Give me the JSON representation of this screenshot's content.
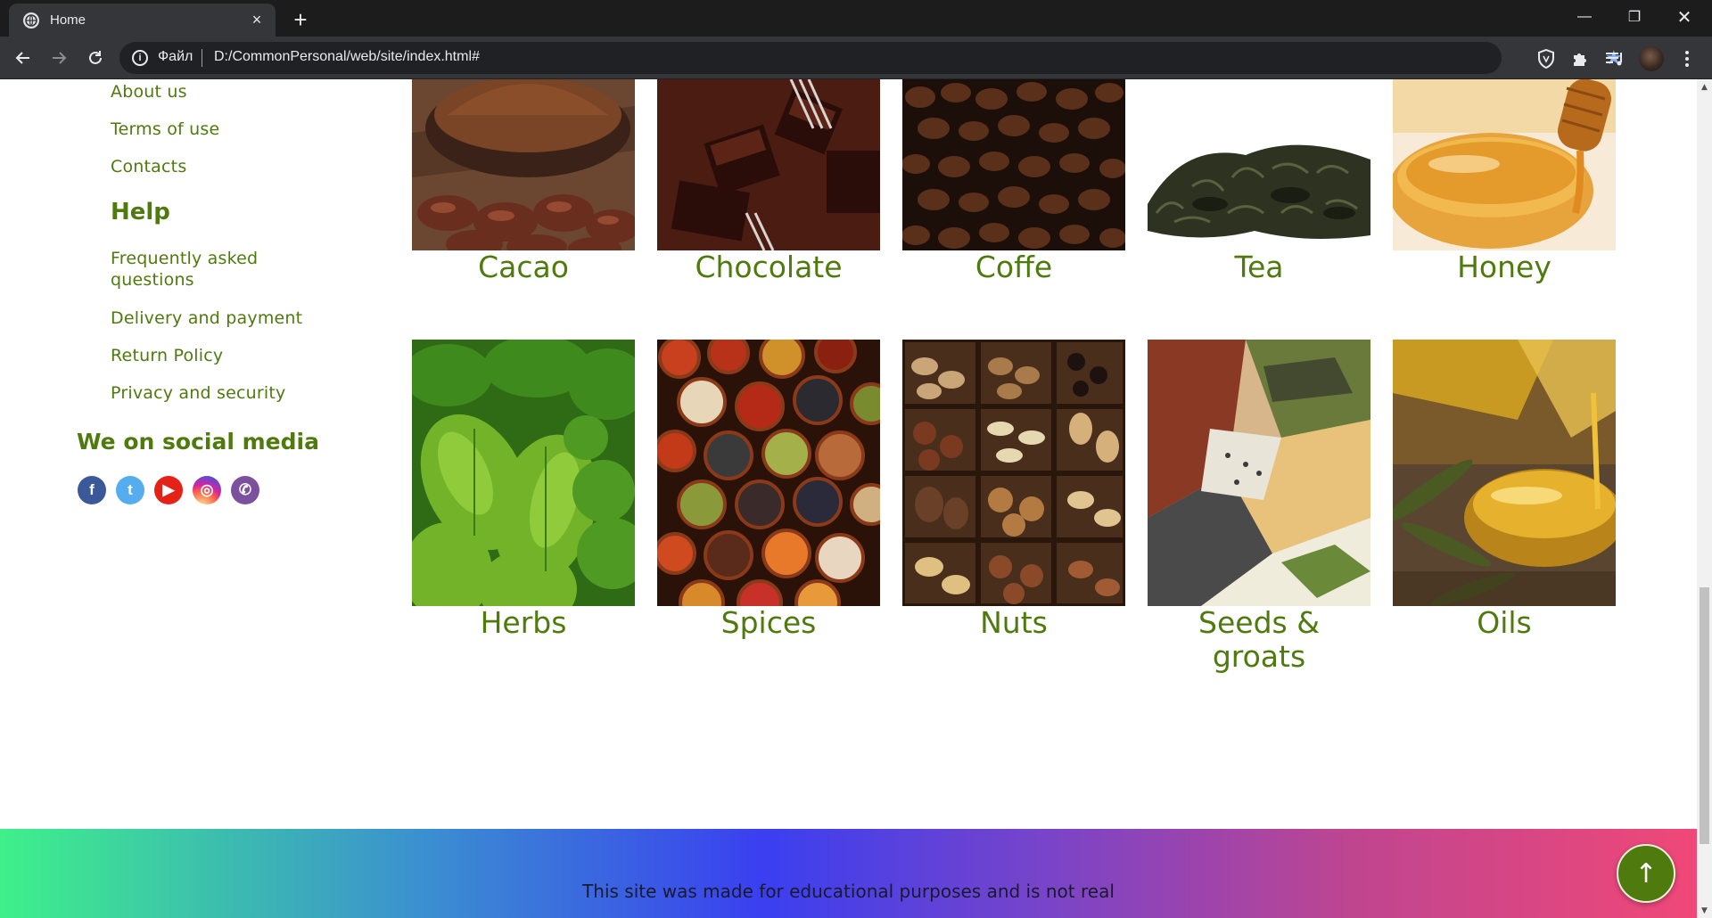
{
  "browser": {
    "tab_title": "Home",
    "tab_close": "×",
    "new_tab": "+",
    "url_scheme": "Файл",
    "url": "D:/CommonPersonal/web/site/index.html#",
    "info_icon": "i",
    "star_icon": "★",
    "minimize": "—",
    "restore": "❐",
    "close": "✕"
  },
  "sidebar": {
    "company_links": [
      "About us",
      "Terms of use",
      "Contacts"
    ],
    "help_heading": "Help",
    "help_links": [
      "Frequently asked questions",
      "Delivery and payment",
      "Return Policy",
      "Privacy and security"
    ],
    "social_heading": "We on social media",
    "social_icons": [
      {
        "name": "facebook-icon",
        "glyph": "f"
      },
      {
        "name": "twitter-icon",
        "glyph": "t"
      },
      {
        "name": "youtube-icon",
        "glyph": "▶"
      },
      {
        "name": "instagram-icon",
        "glyph": "◎"
      },
      {
        "name": "viber-icon",
        "glyph": "✆"
      }
    ]
  },
  "products": [
    {
      "name": "Cacao",
      "image": "cacao-image"
    },
    {
      "name": "Chocolate",
      "image": "chocolate-image"
    },
    {
      "name": "Coffe",
      "image": "coffee-image"
    },
    {
      "name": "Tea",
      "image": "tea-image"
    },
    {
      "name": "Honey",
      "image": "honey-image"
    },
    {
      "name": "Herbs",
      "image": "herbs-image"
    },
    {
      "name": "Spices",
      "image": "spices-image"
    },
    {
      "name": "Nuts",
      "image": "nuts-image"
    },
    {
      "name": "Seeds & groats",
      "image": "seeds-image"
    },
    {
      "name": "Oils",
      "image": "oils-image"
    }
  ],
  "footer": {
    "text": "This site was made for educational purposes and is not real",
    "to_top": "↑"
  },
  "scrollbar": {
    "up": "▲",
    "down": "▼"
  }
}
